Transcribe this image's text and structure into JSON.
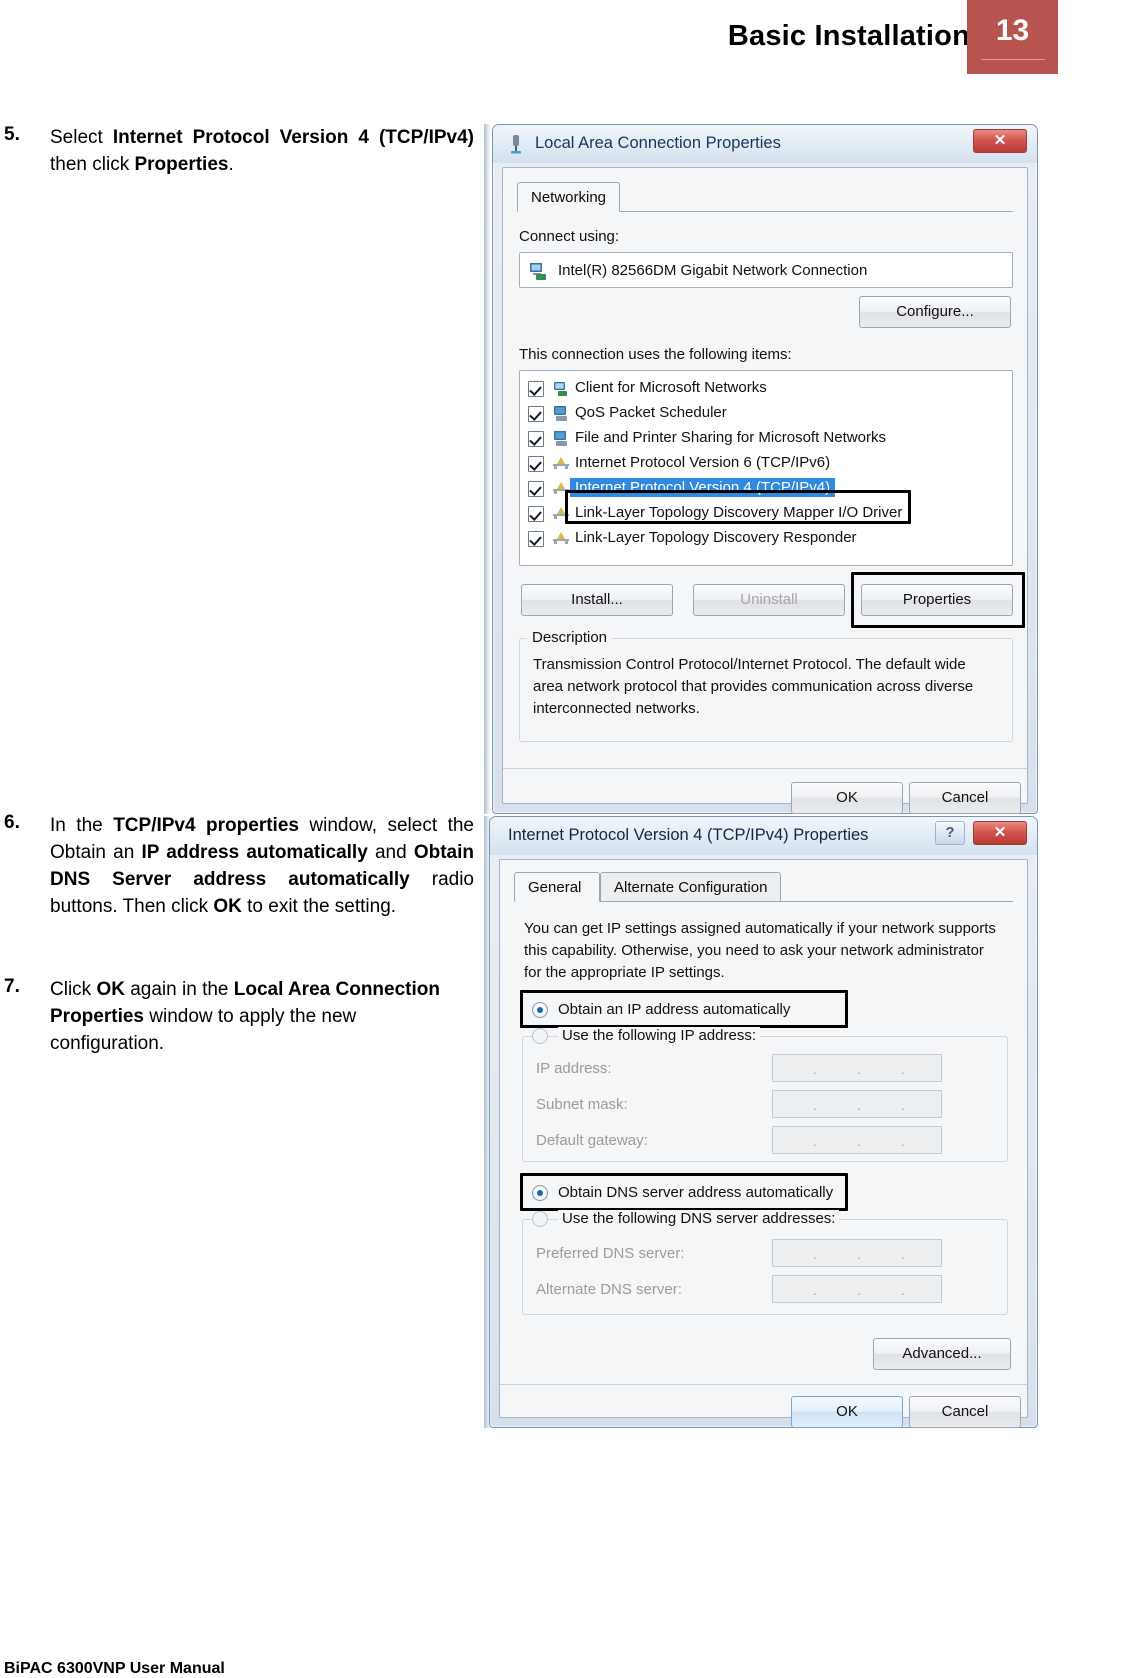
{
  "header": {
    "title": "Basic Installation",
    "page_number": "13"
  },
  "footer": {
    "text": "BiPAC 6300VNP User Manual"
  },
  "steps": [
    {
      "number": "5.",
      "html": "Select <b>Internet Protocol Version 4 (TCP/IPv4)</b> then click <b>Properties</b>."
    },
    {
      "number": "6.",
      "html": "In the <b>TCP/IPv4 properties</b> window, select the Obtain an <b>IP address automatically</b> and <b>Obtain DNS Server address automatically</b> radio buttons. Then click <b>OK</b> to exit the setting."
    },
    {
      "number": "7.",
      "html": "Click <b>OK</b> again in the <b>Local Area Connection Properties</b> window to apply the new configuration."
    }
  ],
  "lan_dialog": {
    "title": "Local Area Connection Properties",
    "title_icon": "network-adapter-icon",
    "close_label": "✕",
    "tabs": [
      {
        "label": "Networking",
        "active": true
      }
    ],
    "connect_using_label": "Connect using:",
    "adapter_name": "Intel(R) 82566DM Gigabit Network Connection",
    "adapter_icon": "network-card-icon",
    "configure_button": "Configure...",
    "items_label": "This connection uses the following items:",
    "items": [
      {
        "label": "Client for Microsoft Networks",
        "checked": true,
        "selected": false,
        "icon": "client-icon"
      },
      {
        "label": "QoS Packet Scheduler",
        "checked": true,
        "selected": false,
        "icon": "service-icon"
      },
      {
        "label": "File and Printer Sharing for Microsoft Networks",
        "checked": true,
        "selected": false,
        "icon": "service-icon"
      },
      {
        "label": "Internet Protocol Version 6 (TCP/IPv6)",
        "checked": true,
        "selected": false,
        "icon": "protocol-icon"
      },
      {
        "label": "Internet Protocol Version 4 (TCP/IPv4)",
        "checked": true,
        "selected": true,
        "icon": "protocol-icon"
      },
      {
        "label": "Link-Layer Topology Discovery Mapper I/O Driver",
        "checked": true,
        "selected": false,
        "icon": "protocol-icon"
      },
      {
        "label": "Link-Layer Topology Discovery Responder",
        "checked": true,
        "selected": false,
        "icon": "protocol-icon"
      }
    ],
    "install_button": "Install...",
    "uninstall_button": "Uninstall",
    "properties_button": "Properties",
    "description_legend": "Description",
    "description_text": "Transmission Control Protocol/Internet Protocol. The default wide area network protocol that provides communication across diverse interconnected networks.",
    "ok_button": "OK",
    "cancel_button": "Cancel"
  },
  "tcpip_dialog": {
    "title": "Internet Protocol Version 4 (TCP/IPv4) Properties",
    "help_label": "?",
    "close_label": "✕",
    "tabs": [
      {
        "label": "General",
        "active": true
      },
      {
        "label": "Alternate Configuration",
        "active": false
      }
    ],
    "intro_text": "You can get IP settings assigned automatically if your network supports this capability. Otherwise, you need to ask your network administrator for the appropriate IP settings.",
    "ip_auto_radio": {
      "label": "Obtain an IP address automatically",
      "selected": true
    },
    "ip_manual_radio": {
      "label": "Use the following IP address:",
      "selected": false
    },
    "ip_fields": [
      {
        "label": "IP address:",
        "value": ""
      },
      {
        "label": "Subnet mask:",
        "value": ""
      },
      {
        "label": "Default gateway:",
        "value": ""
      }
    ],
    "dns_auto_radio": {
      "label": "Obtain DNS server address automatically",
      "selected": true
    },
    "dns_manual_radio": {
      "label": "Use the following DNS server addresses:",
      "selected": false
    },
    "dns_fields": [
      {
        "label": "Preferred DNS server:",
        "value": ""
      },
      {
        "label": "Alternate DNS server:",
        "value": ""
      }
    ],
    "advanced_button": "Advanced...",
    "ok_button": "OK",
    "cancel_button": "Cancel"
  },
  "colors": {
    "badge": "#b85450",
    "selection": "#2f8ae0",
    "title_text": "#15365e"
  }
}
